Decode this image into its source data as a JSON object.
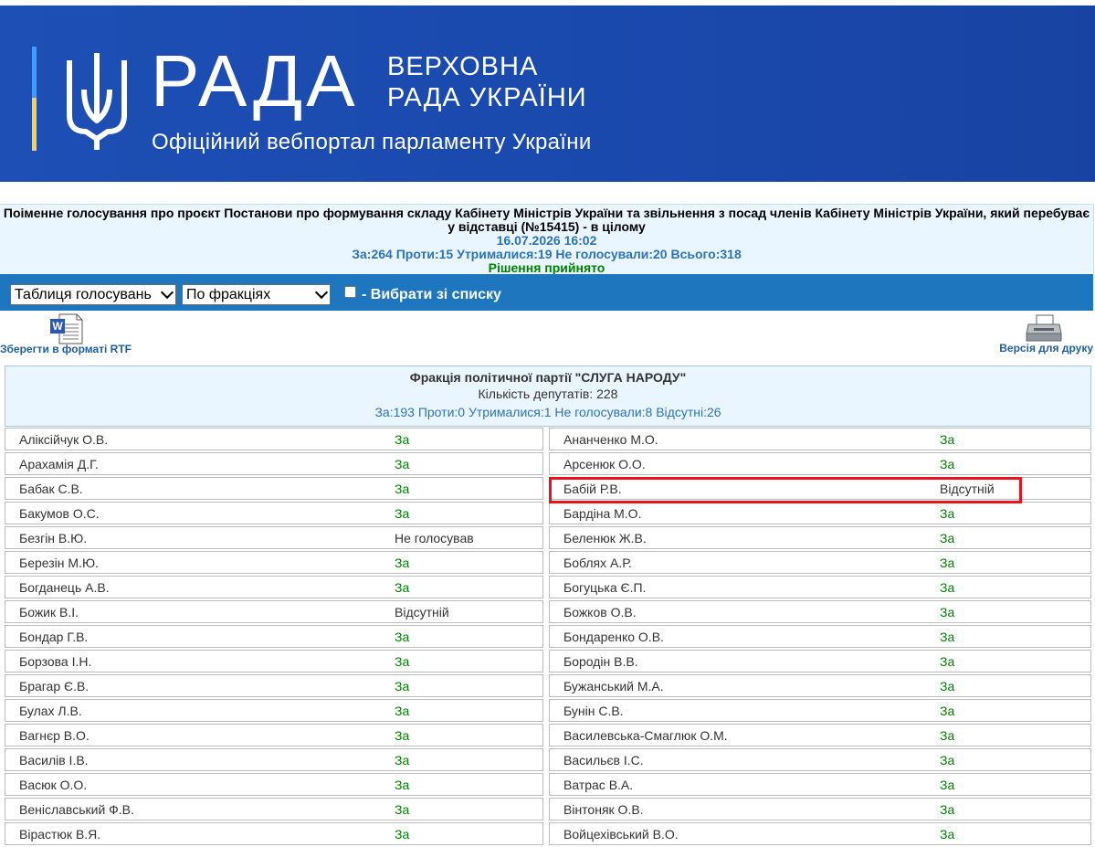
{
  "header": {
    "logo_text": "РАДА",
    "line1": "ВЕРХОВНА",
    "line2": "РАДА УКРАЇНИ",
    "subtitle": "Офіційний вебпортал парламенту України"
  },
  "vote": {
    "title": "Поіменне голосування про проєкт Постанови про формування складу Кабінету Міністрів України та звільнення з посад членів Кабінету Міністрів України, який перебуває у відставці (№15415) - в цілому",
    "datetime": "16.07.2026 16:02",
    "totals": "За:264 Проти:15 Утрималися:19 Не голосували:20 Всього:318",
    "result": "Рішення прийнято"
  },
  "toolbar": {
    "view_select": "Таблиця голосувань",
    "group_select": "По фракціях",
    "checkbox_label": "- Вибрати зі списку"
  },
  "actions": {
    "save_rtf": "Зберегти в форматі RTF",
    "print_version": "Версія для друку"
  },
  "faction": {
    "title": "Фракція політичної партії \"СЛУГА НАРОДУ\"",
    "count": "Кількість депутатів: 228",
    "totals": "За:193 Проти:0 Утрималися:1 Не голосували:8 Відсутні:26"
  },
  "colors": {
    "banner": "#1d4fb4",
    "toolbar": "#1e76bf",
    "vote_za": "#008000",
    "highlight": "#e8141b"
  },
  "rows": [
    {
      "l_name": "Аліксійчук О.В.",
      "l_vote": "За",
      "r_name": "Ананченко М.О.",
      "r_vote": "За"
    },
    {
      "l_name": "Арахамія Д.Г.",
      "l_vote": "За",
      "r_name": "Арсенюк О.О.",
      "r_vote": "За"
    },
    {
      "l_name": "Бабак С.В.",
      "l_vote": "За",
      "r_name": "Бабій Р.В.",
      "r_vote": "Відсутній"
    },
    {
      "l_name": "Бакумов О.С.",
      "l_vote": "За",
      "r_name": "Бардіна М.О.",
      "r_vote": "За"
    },
    {
      "l_name": "Безгін В.Ю.",
      "l_vote": "Не голосував",
      "r_name": "Беленюк Ж.В.",
      "r_vote": "За"
    },
    {
      "l_name": "Березін М.Ю.",
      "l_vote": "За",
      "r_name": "Боблях А.Р.",
      "r_vote": "За"
    },
    {
      "l_name": "Богданець А.В.",
      "l_vote": "За",
      "r_name": "Богуцька Є.П.",
      "r_vote": "За"
    },
    {
      "l_name": "Божик В.І.",
      "l_vote": "Відсутній",
      "r_name": "Божков О.В.",
      "r_vote": "За"
    },
    {
      "l_name": "Бондар Г.В.",
      "l_vote": "За",
      "r_name": "Бондаренко О.В.",
      "r_vote": "За"
    },
    {
      "l_name": "Борзова І.Н.",
      "l_vote": "За",
      "r_name": "Бородін В.В.",
      "r_vote": "За"
    },
    {
      "l_name": "Брагар Є.В.",
      "l_vote": "За",
      "r_name": "Бужанський М.А.",
      "r_vote": "За"
    },
    {
      "l_name": "Булах Л.В.",
      "l_vote": "За",
      "r_name": "Бунін С.В.",
      "r_vote": "За"
    },
    {
      "l_name": "Вагнєр В.О.",
      "l_vote": "За",
      "r_name": "Василевська-Смаглюк О.М.",
      "r_vote": "За"
    },
    {
      "l_name": "Василів І.В.",
      "l_vote": "За",
      "r_name": "Васильєв І.С.",
      "r_vote": "За"
    },
    {
      "l_name": "Васюк О.О.",
      "l_vote": "За",
      "r_name": "Ватрас В.А.",
      "r_vote": "За"
    },
    {
      "l_name": "Веніславський Ф.В.",
      "l_vote": "За",
      "r_name": "Вінтоняк О.В.",
      "r_vote": "За"
    },
    {
      "l_name": "Вірастюк В.Я.",
      "l_vote": "За",
      "r_name": "Войцехівський В.О.",
      "r_vote": "За"
    }
  ]
}
